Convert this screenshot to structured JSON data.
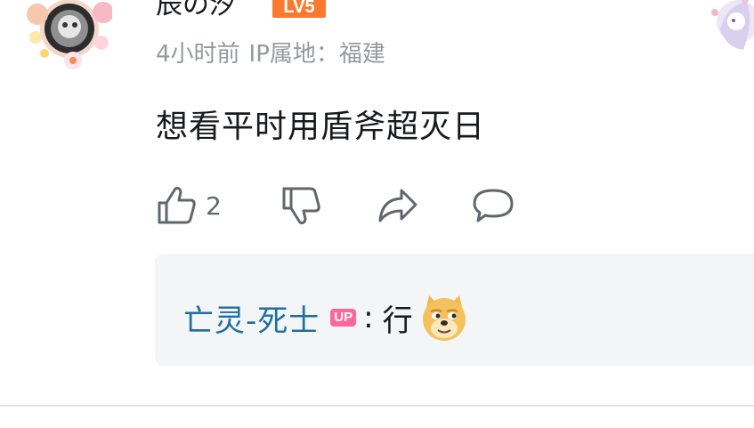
{
  "comment": {
    "username": "辰の汐",
    "level_badge": "LV5",
    "time": "4小时前",
    "ip_location": "IP属地：福建",
    "text": "想看平时用盾斧超灭日",
    "actions": {
      "like_count": "2",
      "like_icon": "thumb-up-icon",
      "dislike_icon": "thumb-down-icon",
      "share_icon": "share-icon",
      "reply_icon": "comment-icon"
    }
  },
  "reply_preview": {
    "username": "亡灵-死士",
    "badge": "UP",
    "separator": ":",
    "text": "行",
    "emote": "doge-emote"
  },
  "colors": {
    "username_link": "#1d6fa0",
    "meta_gray": "#9499a0",
    "level_badge": "#f97a2f",
    "up_badge": "#ff6699",
    "reply_bg": "#f4f5f7"
  }
}
